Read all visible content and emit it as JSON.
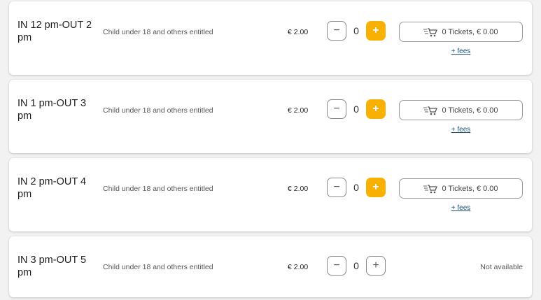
{
  "tickets": [
    {
      "title": "IN 12 pm-OUT 2 pm",
      "description": "Child under 18 and others entitled",
      "price": "€ 2.00",
      "minus": "−",
      "quantity": "0",
      "plus": "+",
      "plus_enabled": true,
      "cart_label": "0 Tickets, € 0.00",
      "fees": "+ fees"
    },
    {
      "title": "IN 1 pm-OUT 3 pm",
      "description": "Child under 18 and others entitled",
      "price": "€ 2.00",
      "minus": "−",
      "quantity": "0",
      "plus": "+",
      "plus_enabled": true,
      "cart_label": "0 Tickets, € 0.00",
      "fees": "+ fees"
    },
    {
      "title": "IN 2 pm-OUT 4 pm",
      "description": "Child under 18 and others entitled",
      "price": "€ 2.00",
      "minus": "−",
      "quantity": "0",
      "plus": "+",
      "plus_enabled": true,
      "cart_label": "0 Tickets, € 0.00",
      "fees": "+ fees"
    },
    {
      "title": "IN 3 pm-OUT 5 pm",
      "description": "Child under 18 and others entitled",
      "price": "€ 2.00",
      "minus": "−",
      "quantity": "0",
      "plus": "+",
      "plus_enabled": false,
      "status": "Not available"
    }
  ],
  "icons": {
    "cart": "shopping-cart-icon"
  },
  "colors": {
    "accent": "#f8b100",
    "link": "#1a5276",
    "card_background": "#ffffff",
    "page_background": "#f2f2f2"
  }
}
